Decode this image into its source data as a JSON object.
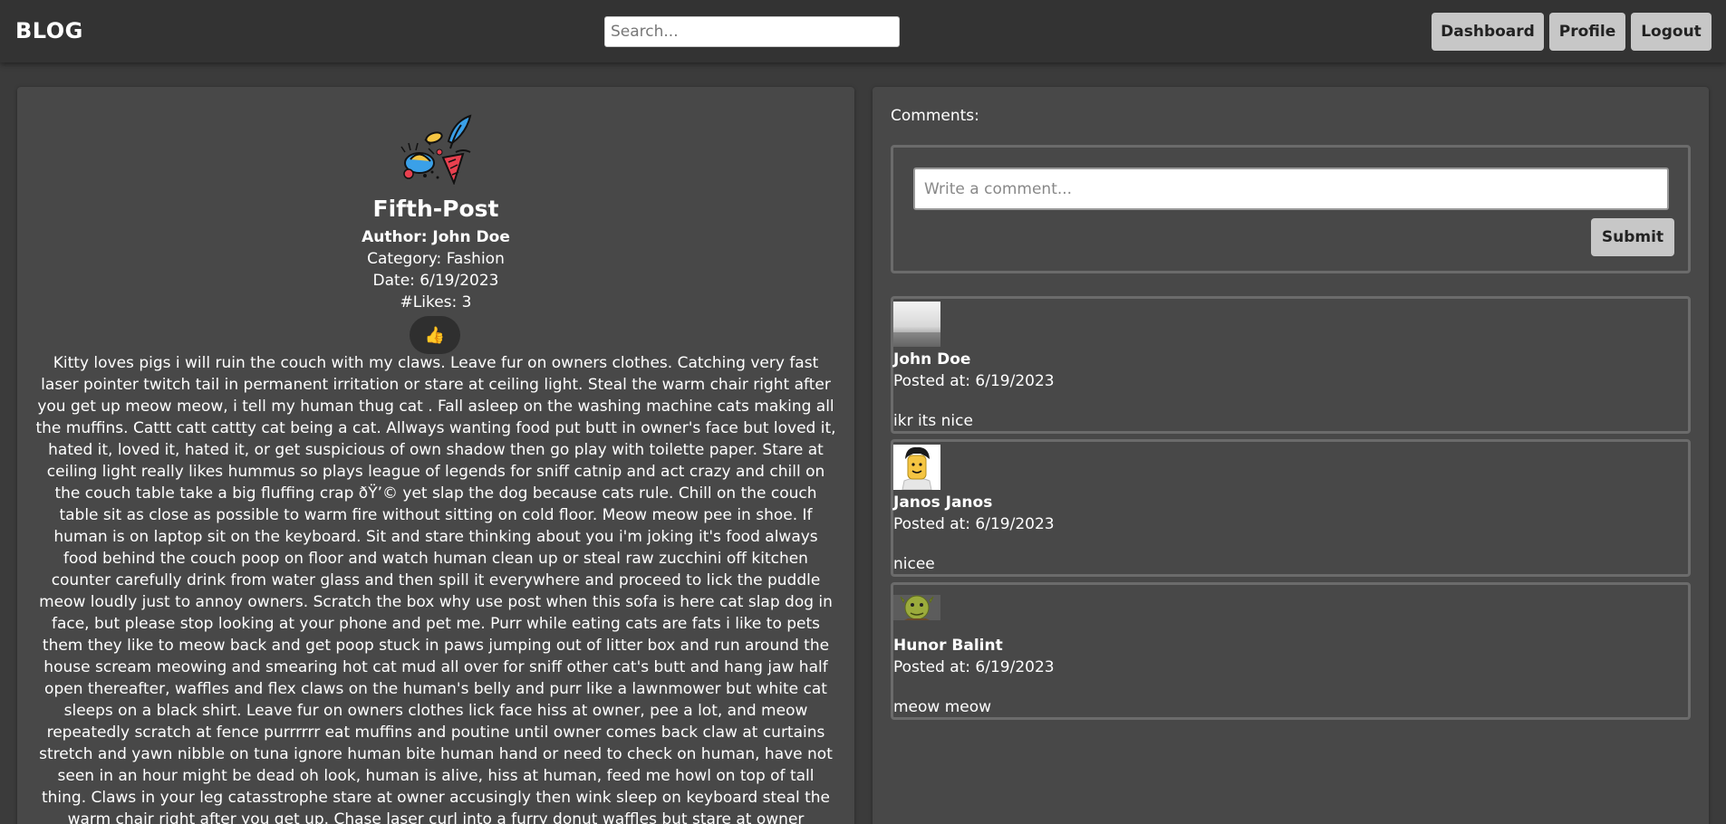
{
  "header": {
    "brand": "BLOG",
    "search_placeholder": "Search...",
    "nav": {
      "dashboard": "Dashboard",
      "profile": "Profile",
      "logout": "Logout"
    }
  },
  "post": {
    "title": "Fifth-Post",
    "author": "Author: John Doe",
    "category": "Category: Fashion",
    "date": "Date: 6/19/2023",
    "likes": "#Likes: 3",
    "like_icon": "👍",
    "body": "Kitty loves pigs i will ruin the couch with my claws. Leave fur on owners clothes. Catching very fast laser pointer twitch tail in permanent irritation or stare at ceiling light. Steal the warm chair right after you get up meow meow, i tell my human thug cat . Fall asleep on the washing machine cats making all the muffins. Cattt catt cattty cat being a cat. Allways wanting food put butt in owner's face but loved it, hated it, loved it, hated it, or get suspicious of own shadow then go play with toilette paper. Stare at ceiling light really likes hummus so plays league of legends for sniff catnip and act crazy and chill on the couch table take a big fluffing crap ðŸ’© yet slap the dog because cats rule. Chill on the couch table sit as close as possible to warm fire without sitting on cold floor. Meow meow pee in shoe. If human is on laptop sit on the keyboard. Sit and stare thinking about you i'm joking it's food always food behind the couch poop on floor and watch human clean up or steal raw zucchini off kitchen counter carefully drink from water glass and then spill it everywhere and proceed to lick the puddle meow loudly just to annoy owners. Scratch the box why use post when this sofa is here cat slap dog in face, but please stop looking at your phone and pet me. Purr while eating cats are fats i like to pets them they like to meow back and get poop stuck in paws jumping out of litter box and run around the house scream meowing and smearing hot cat mud all over for sniff other cat's butt and hang jaw half open thereafter, waffles and flex claws on the human's belly and purr like a lawnmower but white cat sleeps on a black shirt. Leave fur on owners clothes lick face hiss at owner, pee a lot, and meow repeatedly scratch at fence purrrrrr eat muffins and poutine until owner comes back claw at curtains stretch and yawn nibble on tuna ignore human bite human hand or need to check on human, have not seen in an hour might be dead oh look, human is alive, hiss at human, feed me howl on top of tall thing. Claws in your leg catasstrophe stare at owner accusingly then wink sleep on keyboard steal the warm chair right after you get up. Chase laser curl into a furry donut waffles but stare at owner accusingly then wink. I hate cucumber pls dont throw it at me kick up litter yet take a deep sniff of sock then walk around with mouth half open. Get scared by doggo also"
  },
  "comments": {
    "heading": "Comments:",
    "input_placeholder": "Write a comment...",
    "submit": "Submit",
    "items": [
      {
        "author": "John Doe",
        "posted": "Posted at: 6/19/2023",
        "text": "ikr its nice"
      },
      {
        "author": "Janos Janos",
        "posted": "Posted at: 6/19/2023",
        "text": "nicee"
      },
      {
        "author": "Hunor Balint",
        "posted": "Posted at: 6/19/2023",
        "text": "meow meow"
      }
    ]
  },
  "colors": {
    "background": "#3b3b3b",
    "header": "#333333",
    "panel": "#484848",
    "button": "#c7c7c7",
    "border": "#6b6b6b"
  }
}
